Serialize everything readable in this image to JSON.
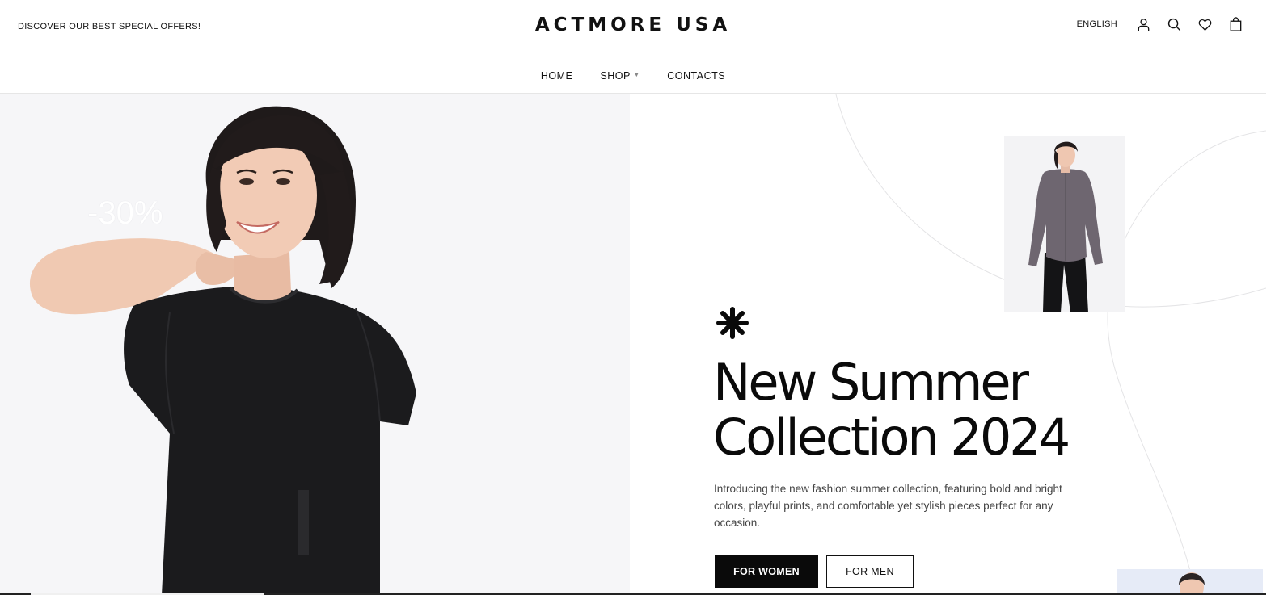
{
  "header": {
    "promo_text": "DISCOVER OUR BEST SPECIAL OFFERS!",
    "logo_text": "ACTMORE USA",
    "language": "ENGLISH",
    "icons": [
      "user-icon",
      "search-icon",
      "heart-icon",
      "shopping-bag-icon"
    ]
  },
  "nav": {
    "items": [
      {
        "label": "HOME"
      },
      {
        "label": "SHOP",
        "has_dropdown": true
      },
      {
        "label": "CONTACTS"
      }
    ]
  },
  "hero": {
    "discount_label": "-30%",
    "title_line1": "New Summer",
    "title_line2": "Collection 2024",
    "description": "Introducing the new fashion summer collection, featuring bold and bright colors, playful prints, and comfortable yet stylish pieces perfect for any occasion.",
    "buttons": {
      "women": "FOR WOMEN",
      "men": "FOR MEN"
    },
    "accent_icon": "asterisk-icon"
  },
  "colors": {
    "text": "#111111",
    "primary_button": "#0a0a0a",
    "hero_left_bg": "#f6f6f8",
    "shirt": "#1b1b1d",
    "jacket": "#6e6670"
  }
}
